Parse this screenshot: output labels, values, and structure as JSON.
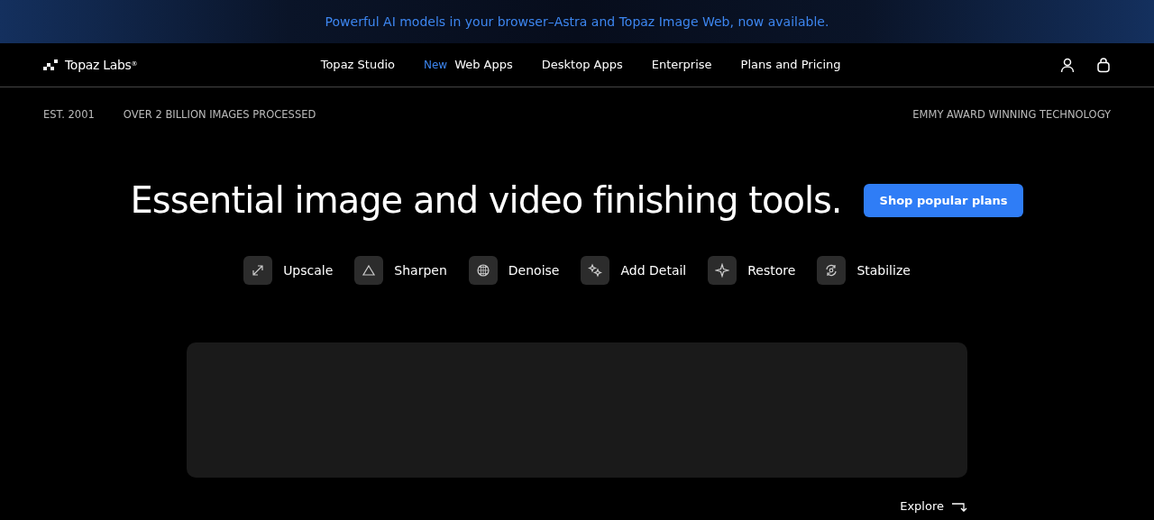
{
  "banner": {
    "text": "Powerful AI models in your browser–Astra and Topaz Image Web, now available."
  },
  "navbar": {
    "brand": "Topaz Labs",
    "brand_mark": "®",
    "links": [
      {
        "label": "Topaz Studio"
      },
      {
        "label": "Web Apps",
        "badge": "New"
      },
      {
        "label": "Desktop Apps"
      },
      {
        "label": "Enterprise"
      },
      {
        "label": "Plans and Pricing"
      }
    ]
  },
  "stats": {
    "left": [
      "EST. 2001",
      "OVER 2 BILLION IMAGES PROCESSED"
    ],
    "right": "EMMY AWARD WINNING TECHNOLOGY"
  },
  "hero": {
    "heading": "Essential image and video finishing tools.",
    "button": "Shop popular plans"
  },
  "features": [
    {
      "label": "Upscale",
      "kind": "upscale"
    },
    {
      "label": "Sharpen",
      "kind": "sharpen"
    },
    {
      "label": "Denoise",
      "kind": "denoise"
    },
    {
      "label": "Add Detail",
      "kind": "detail"
    },
    {
      "label": "Restore",
      "kind": "restore"
    },
    {
      "label": "Stabilize",
      "kind": "stabilize"
    }
  ],
  "explore": "Explore"
}
